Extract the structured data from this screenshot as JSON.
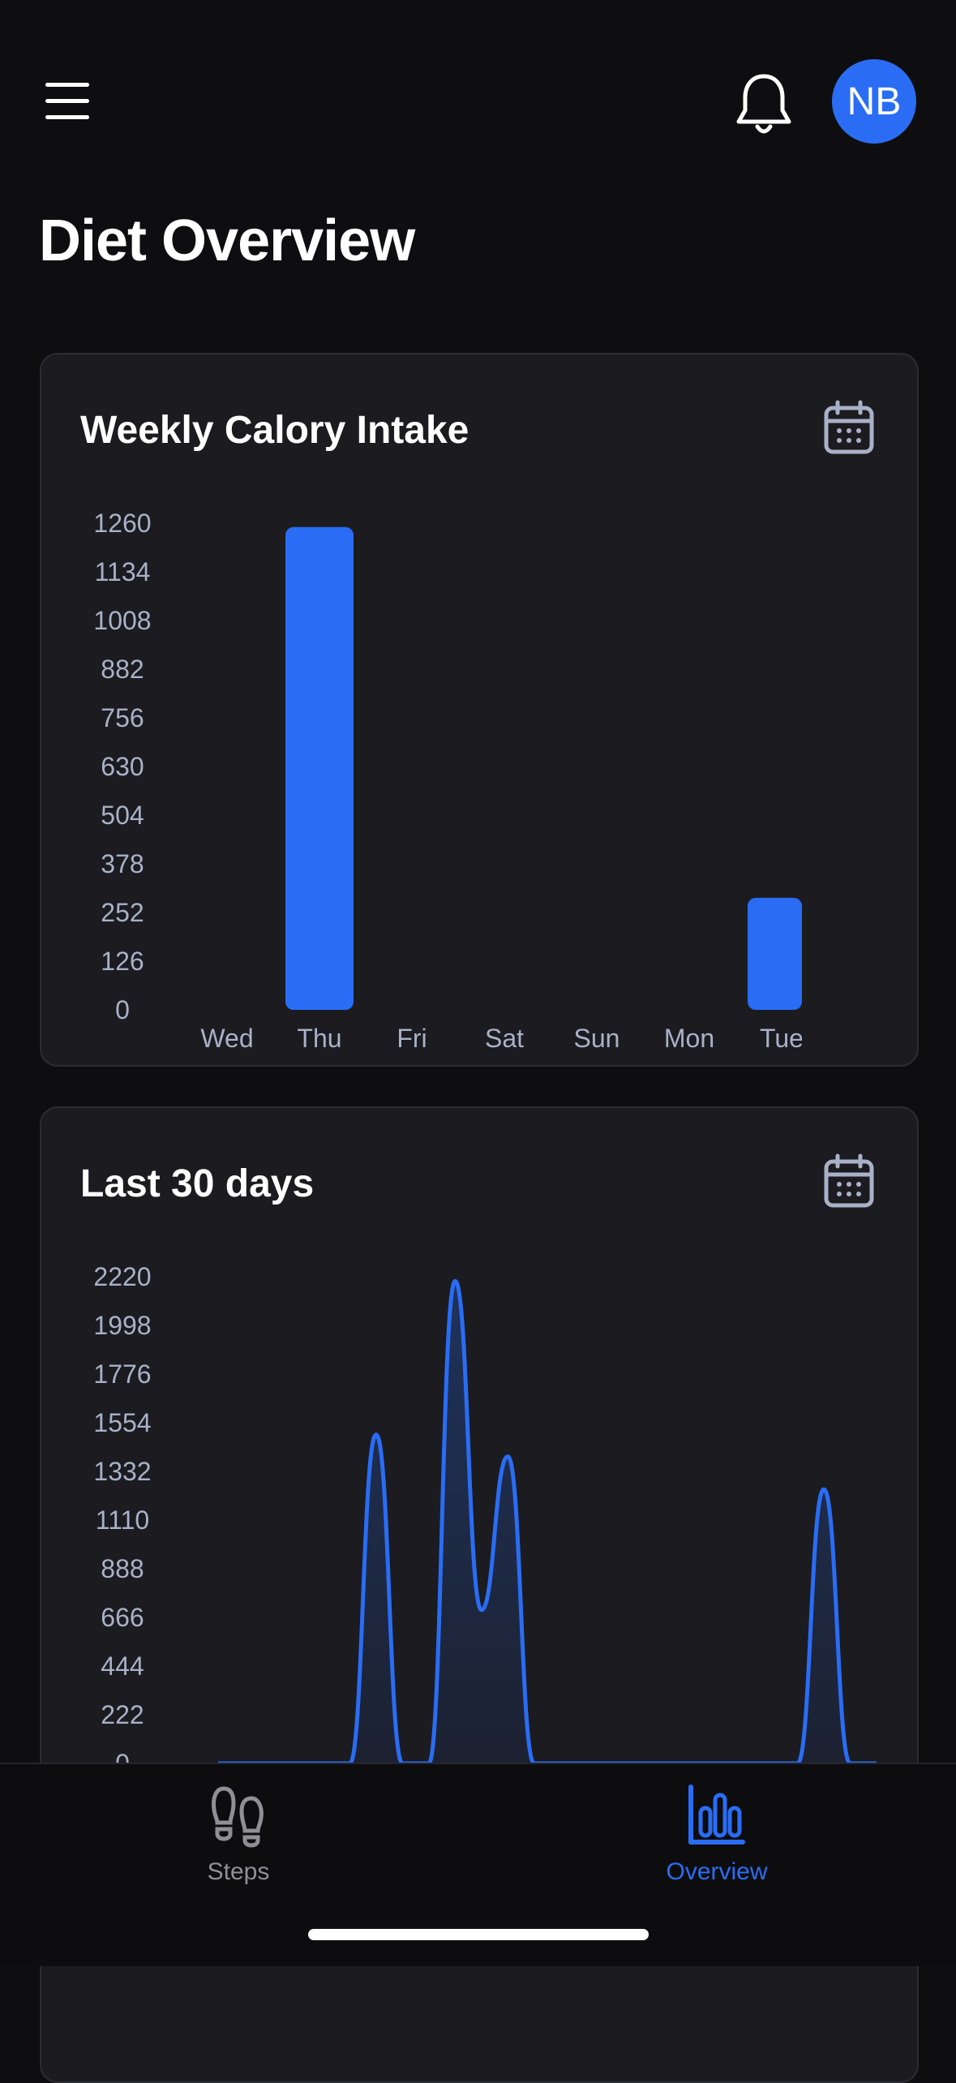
{
  "header": {
    "avatar_initials": "NB",
    "menu_icon": "hamburger-menu-icon",
    "bell_icon": "bell-icon"
  },
  "page": {
    "title": "Diet Overview"
  },
  "colors": {
    "accent": "#2a6df4",
    "background": "#0e0e10",
    "card": "#1b1b20",
    "muted": "#a9b1c8"
  },
  "weekly": {
    "title": "Weekly Calory Intake",
    "icon": "calendar-icon",
    "chart_data": {
      "type": "bar",
      "categories": [
        "Wed",
        "Thu",
        "Fri",
        "Sat",
        "Sun",
        "Mon",
        "Tue"
      ],
      "values": [
        0,
        1250,
        0,
        0,
        0,
        0,
        290
      ],
      "yticks": [
        1260,
        1134,
        1008,
        882,
        756,
        630,
        504,
        378,
        252,
        126,
        0
      ],
      "ylim": [
        0,
        1260
      ],
      "xlabel": "",
      "ylabel": ""
    }
  },
  "last30": {
    "title": "Last 30 days",
    "icon": "calendar-icon",
    "chart_data": {
      "type": "area",
      "yticks": [
        2220,
        1998,
        1776,
        1554,
        1332,
        1110,
        888,
        666,
        444,
        222,
        0
      ],
      "ylim": [
        0,
        2220
      ],
      "values": [
        0,
        0,
        0,
        0,
        0,
        0,
        1500,
        0,
        0,
        2200,
        700,
        1400,
        0,
        0,
        0,
        0,
        0,
        0,
        0,
        0,
        0,
        0,
        0,
        1250,
        0,
        0
      ],
      "xlabel": "",
      "ylabel": ""
    }
  },
  "nav": {
    "steps_label": "Steps",
    "overview_label": "Overview",
    "steps_icon": "footsteps-icon",
    "overview_icon": "bar-chart-icon"
  }
}
